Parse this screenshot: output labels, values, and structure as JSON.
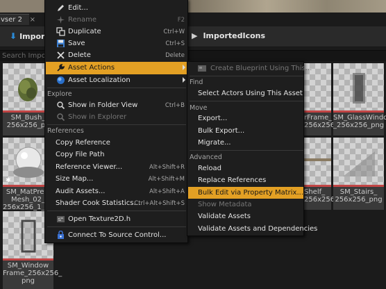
{
  "browser": {
    "tab_label": "vser 2",
    "tab_close": "×",
    "folder_button": "Impor",
    "breadcrumb": "ImportedIcons",
    "search_placeholder": "Search Importe"
  },
  "tiles": [
    {
      "label": "SM_Bush_ 256x256_pn"
    },
    {
      "label": "SM_MatPrevi Mesh_02_ 256x256_1_pn"
    },
    {
      "label": "SM_Window Frame_256x256_ png"
    },
    {
      "label": "rFrame_ 256x256_png"
    },
    {
      "label": "SM_GlassWindow _256x256_png"
    },
    {
      "label": "Shelf_ 256x256_png"
    },
    {
      "label": "SM_Stairs_ 256x256_png"
    }
  ],
  "context_menu": {
    "items": [
      {
        "label": "Edit...",
        "shortcut": "",
        "icon": "pencil-icon"
      },
      {
        "label": "Rename",
        "shortcut": "F2",
        "icon": "rename-icon"
      },
      {
        "label": "Duplicate",
        "shortcut": "Ctrl+W",
        "icon": "duplicate-icon"
      },
      {
        "label": "Save",
        "shortcut": "Ctrl+S",
        "icon": "save-icon"
      },
      {
        "label": "Delete",
        "shortcut": "Delete",
        "icon": "delete-icon"
      },
      {
        "label": "Asset Actions",
        "shortcut": "",
        "icon": "wrench-icon"
      },
      {
        "label": "Asset Localization",
        "shortcut": "",
        "icon": "globe-icon"
      }
    ],
    "explore_header": "Explore",
    "explore_items": [
      {
        "label": "Show in Folder View",
        "shortcut": "Ctrl+B",
        "icon": "search-icon"
      },
      {
        "label": "Show in Explorer",
        "shortcut": "",
        "icon": "search-icon"
      }
    ],
    "references_header": "References",
    "reference_items": [
      {
        "label": "Copy Reference",
        "shortcut": ""
      },
      {
        "label": "Copy File Path",
        "shortcut": ""
      },
      {
        "label": "Reference Viewer...",
        "shortcut": "Alt+Shift+R"
      },
      {
        "label": "Size Map...",
        "shortcut": "Alt+Shift+M"
      },
      {
        "label": "Audit Assets...",
        "shortcut": "Alt+Shift+A"
      },
      {
        "label": "Shader Cook Statistics...",
        "shortcut": "Ctrl+Alt+Shift+S"
      }
    ],
    "open_item": {
      "label": "Open Texture2D.h",
      "icon": "code-file-icon"
    },
    "source_control_item": {
      "label": "Connect To Source Control...",
      "icon": "source-control-icon"
    }
  },
  "submenu": {
    "create_blueprint": "Create Blueprint Using This...",
    "find_header": "Find",
    "select_actors": "Select Actors Using This Asset",
    "move_header": "Move",
    "export": "Export...",
    "bulk_export": "Bulk Export...",
    "migrate": "Migrate...",
    "advanced_header": "Advanced",
    "reload": "Reload",
    "replace_references": "Replace References",
    "bulk_edit": "Bulk Edit via Property Matrix...",
    "show_metadata": "Show Metadata",
    "validate_assets": "Validate Assets",
    "validate_assets_deps": "Validate Assets and Dependencies"
  },
  "colors": {
    "highlight": "#e3a024",
    "menu_bg": "#1e1e1e",
    "unsaved_bar": "#c24545",
    "folder_arrow": "#2b8cd9"
  }
}
